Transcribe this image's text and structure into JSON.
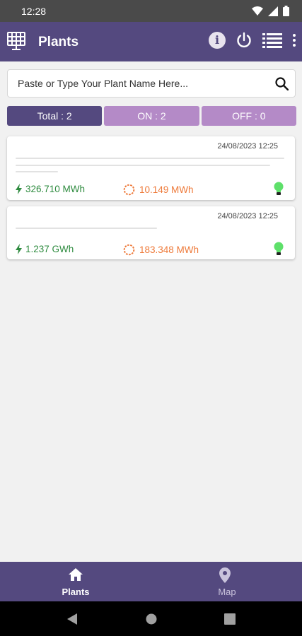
{
  "status_bar": {
    "time": "12:28",
    "icons": [
      "wifi-icon",
      "signal-icon",
      "battery-icon"
    ]
  },
  "app_bar": {
    "title": "Plants",
    "logo_icon": "solar-panel-icon",
    "actions": [
      "info-icon",
      "power-icon",
      "list-icon",
      "more-vert-icon"
    ],
    "info_label": "i"
  },
  "search": {
    "placeholder": "Paste or Type Your Plant Name Here...",
    "value": ""
  },
  "filters": [
    {
      "label": "Total : 2",
      "active": true
    },
    {
      "label": "ON : 2",
      "active": false
    },
    {
      "label": "OFF : 0",
      "active": false
    }
  ],
  "plants": [
    {
      "timestamp": "24/08/2023 12:25",
      "energy": "326.710 MWh",
      "power": "10.149 MWh",
      "status": "on"
    },
    {
      "timestamp": "24/08/2023 12:25",
      "energy": "1.237 GWh",
      "power": "183.348 MWh",
      "status": "on"
    }
  ],
  "bottom_nav": [
    {
      "label": "Plants",
      "icon": "home-icon",
      "active": true
    },
    {
      "label": "Map",
      "icon": "location-pin-icon",
      "active": false
    }
  ],
  "colors": {
    "primary": "#54497f",
    "filter_inactive": "#b48ac7",
    "energy_green": "#2e8b3f",
    "power_orange": "#ee7a3a",
    "bulb_green": "#5ee06a"
  }
}
